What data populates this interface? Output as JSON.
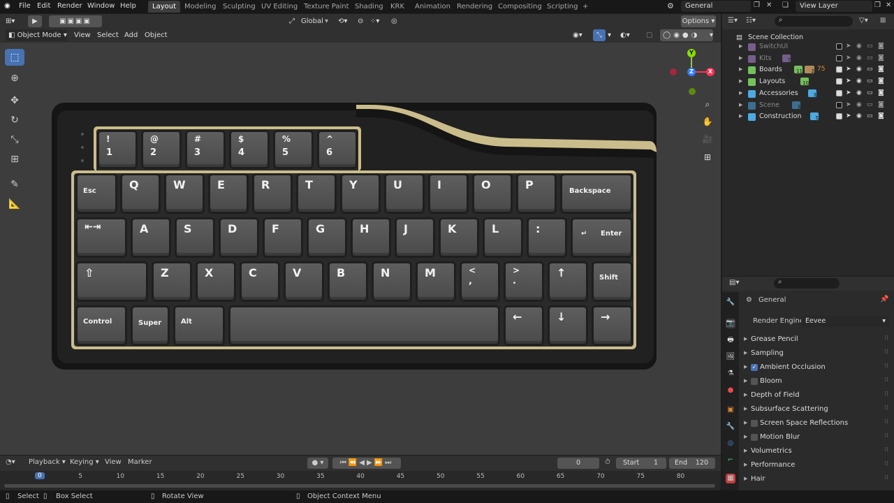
{
  "topbar": {
    "menus": [
      "File",
      "Edit",
      "Render",
      "Window",
      "Help"
    ],
    "workspaces": [
      "Layout",
      "Modeling",
      "Sculpting",
      "UV Editing",
      "Texture Paint",
      "Shading",
      "KRK",
      "Animation",
      "Rendering",
      "Compositing",
      "Scripting"
    ],
    "active_workspace": "Layout",
    "scene_name": "General",
    "view_layer": "View Layer"
  },
  "header3d": {
    "transform_orientation": "Global",
    "options_label": "Options",
    "mode": "Object Mode",
    "menus": [
      "View",
      "Select",
      "Add",
      "Object"
    ]
  },
  "keyboard": {
    "row_top": [
      [
        "!",
        "1"
      ],
      [
        "@",
        "2"
      ],
      [
        "#",
        "3"
      ],
      [
        "$",
        "4"
      ],
      [
        "%",
        "5"
      ],
      [
        "^",
        "6"
      ]
    ],
    "row_q": [
      "Esc",
      "Q",
      "W",
      "E",
      "R",
      "T",
      "Y",
      "U",
      "I",
      "O",
      "P",
      "Backspace"
    ],
    "row_a": [
      "⇤⇥",
      "A",
      "S",
      "D",
      "F",
      "G",
      "H",
      "J",
      "K",
      "L",
      ":",
      "Enter"
    ],
    "row_z": [
      "⇧",
      "Z",
      "X",
      "C",
      "V",
      "B",
      "N",
      "M",
      "<",
      ">",
      "↑",
      "Shift"
    ],
    "row_z_sub": [
      "",
      ",",
      "."
    ],
    "row_bottom": [
      "Control",
      "Super",
      "Alt",
      "",
      "←",
      "↓",
      "→"
    ]
  },
  "outliner": {
    "root": "Scene Collection",
    "items": [
      {
        "name": "SwitchUI",
        "color": "#b28dd8",
        "dim": true,
        "count": "",
        "checked": false
      },
      {
        "name": "Kits",
        "color": "#b28dd8",
        "dim": true,
        "count": "7",
        "checked": false
      },
      {
        "name": "Boards",
        "color": "#75c15c",
        "dim": false,
        "count": "11",
        "checked": true
      },
      {
        "name": "Layouts",
        "color": "#75c15c",
        "dim": false,
        "count": "10",
        "checked": true
      },
      {
        "name": "Accessories",
        "color": "#4fa8e0",
        "dim": false,
        "count": "3",
        "checked": true
      },
      {
        "name": "Scene",
        "color": "#4fa8e0",
        "dim": true,
        "count": "3",
        "checked": false
      },
      {
        "name": "Construction",
        "color": "#4fa8e0",
        "dim": false,
        "count": "5",
        "checked": true
      }
    ],
    "extra_counts": {
      "boards_b": "2",
      "boards_c": "75"
    }
  },
  "properties": {
    "tab_title": "General",
    "render_engine_label": "Render Engine",
    "render_engine": "Eevee",
    "panels": [
      {
        "label": "Grease Pencil",
        "checkbox": null
      },
      {
        "label": "Sampling",
        "checkbox": null
      },
      {
        "label": "Ambient Occlusion",
        "checkbox": true
      },
      {
        "label": "Bloom",
        "checkbox": false
      },
      {
        "label": "Depth of Field",
        "checkbox": null
      },
      {
        "label": "Subsurface Scattering",
        "checkbox": null
      },
      {
        "label": "Screen Space Reflections",
        "checkbox": false
      },
      {
        "label": "Motion Blur",
        "checkbox": false
      },
      {
        "label": "Volumetrics",
        "checkbox": null
      },
      {
        "label": "Performance",
        "checkbox": null
      },
      {
        "label": "Hair",
        "checkbox": null
      }
    ]
  },
  "timeline": {
    "menus": [
      "Playback",
      "Keying",
      "View",
      "Marker"
    ],
    "current_frame": "0",
    "start_label": "Start",
    "start": "1",
    "end_label": "End",
    "end": "120",
    "ticks": [
      "0",
      "5",
      "10",
      "15",
      "20",
      "25",
      "30",
      "35",
      "40",
      "45",
      "50",
      "55",
      "60",
      "65",
      "70",
      "75",
      "80"
    ]
  },
  "statusbar": {
    "items": [
      "Select",
      "Box Select",
      "Rotate View",
      "Object Context Menu"
    ]
  },
  "gizmo": {
    "y": "Y",
    "z": "Z",
    "x": "X"
  }
}
